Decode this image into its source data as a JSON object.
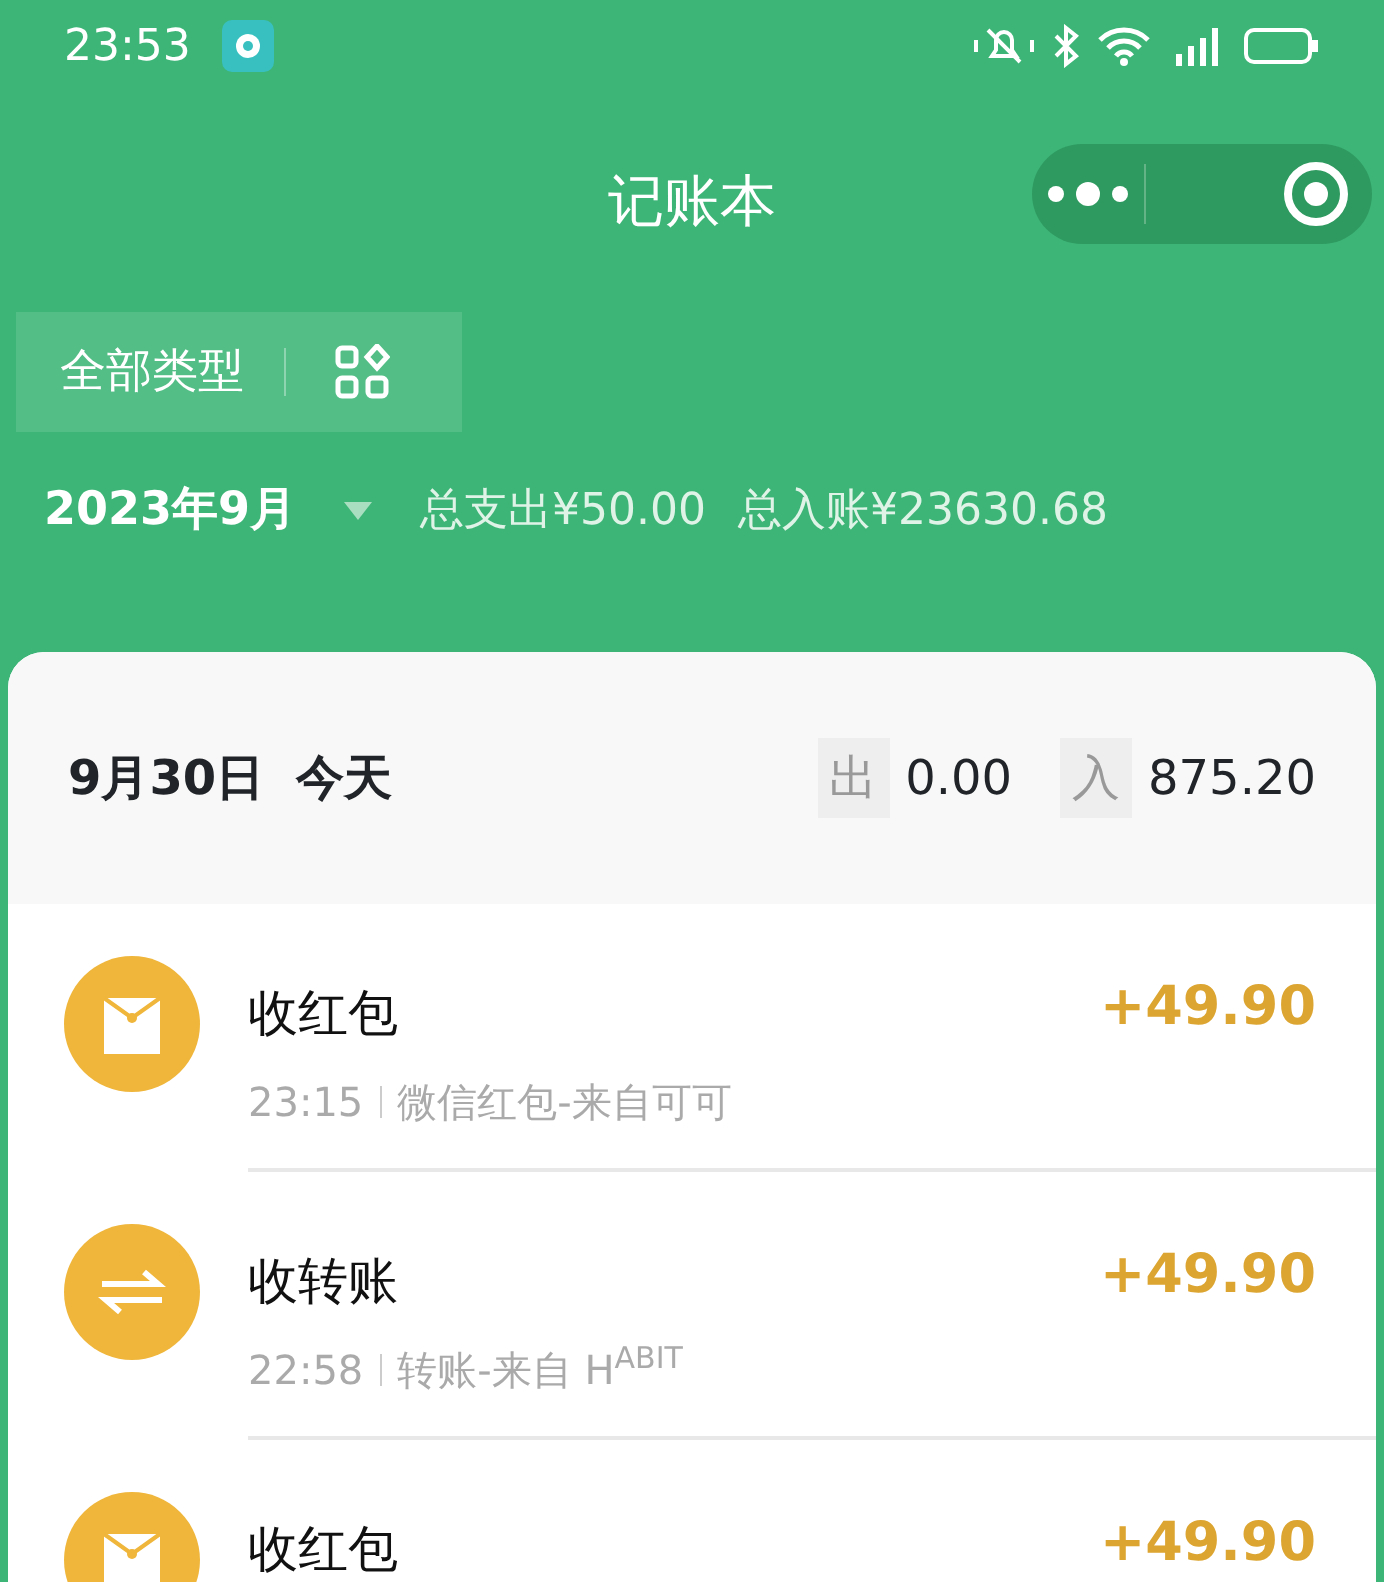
{
  "status_bar": {
    "time": "23:53"
  },
  "nav": {
    "title": "记账本"
  },
  "filter": {
    "label": "全部类型"
  },
  "summary": {
    "month": "2023年9月",
    "expense": "总支出¥50.00",
    "income": "总入账¥23630.68"
  },
  "day": {
    "date": "9月30日",
    "relative": "今天",
    "out_label": "出",
    "out_value": "0.00",
    "in_label": "入",
    "in_value": "875.20"
  },
  "records": [
    {
      "kind": "red-packet",
      "title": "收红包",
      "time": "23:15",
      "detail": "微信红包-来自可可",
      "amount": "+49.90"
    },
    {
      "kind": "transfer",
      "title": "收转账",
      "time": "22:58",
      "detail": "转账-来自 H$^{ABIT}$",
      "amount": "+49.90"
    },
    {
      "kind": "red-packet",
      "title": "收红包",
      "amount": "+49.90"
    }
  ]
}
